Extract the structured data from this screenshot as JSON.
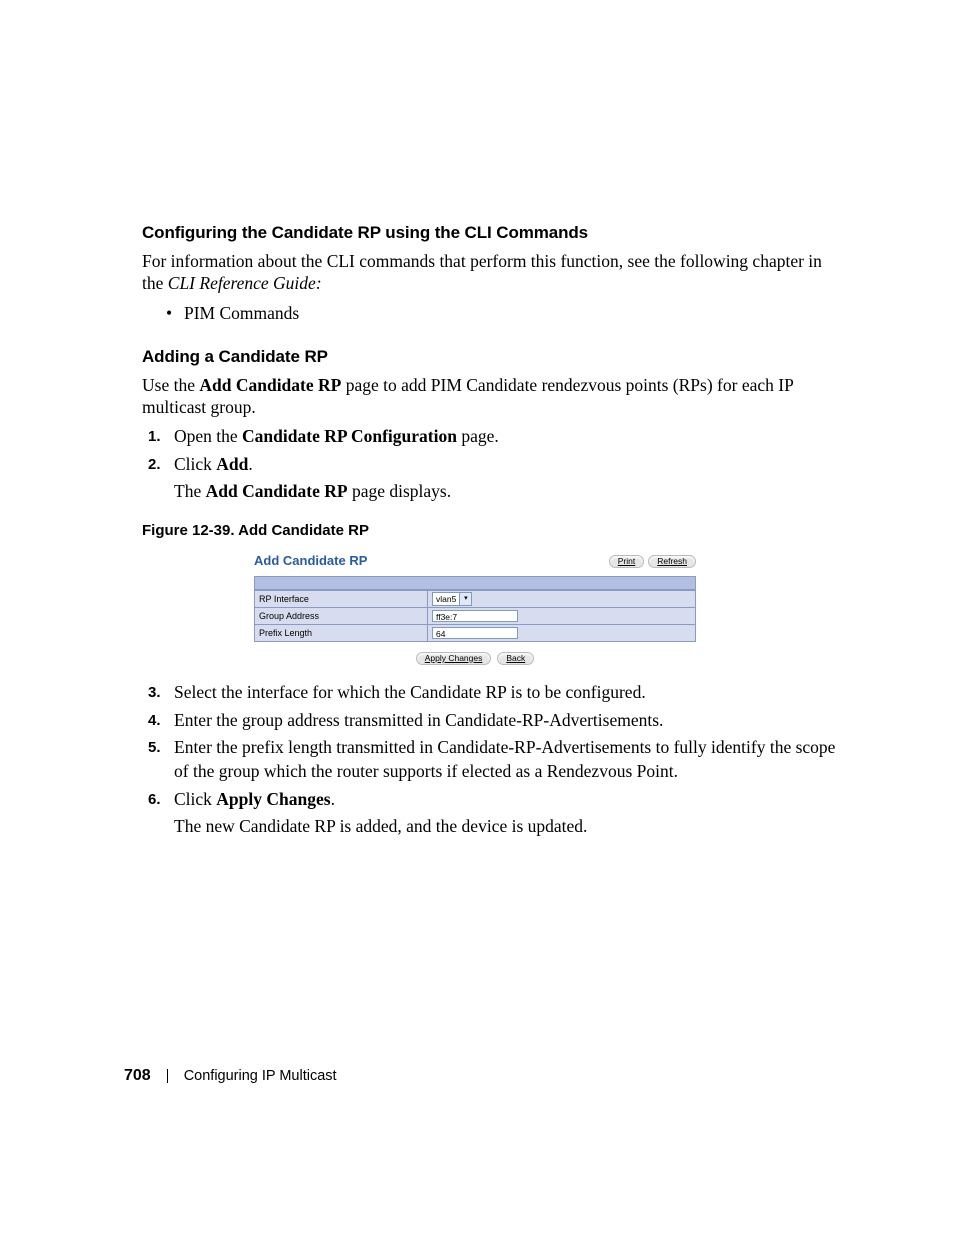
{
  "section1": {
    "heading": "Configuring the Candidate RP using the CLI Commands",
    "para_a": "For information about the CLI commands that perform this function, see the following chapter in the ",
    "para_b": "CLI Reference Guide:",
    "bullet1": "PIM Commands"
  },
  "section2": {
    "heading": "Adding a Candidate RP",
    "para_pre": "Use the ",
    "para_bold": "Add Candidate RP",
    "para_post": " page to add PIM Candidate rendezvous points (RPs) for each IP multicast group."
  },
  "steps_a": {
    "s1_pre": "Open the ",
    "s1_bold": "Candidate RP Configuration",
    "s1_post": " page.",
    "s2_pre": "Click ",
    "s2_bold": "Add",
    "s2_post": ".",
    "s2_sub_pre": "The ",
    "s2_sub_bold": "Add Candidate RP",
    "s2_sub_post": " page displays."
  },
  "figure": {
    "caption": "Figure 12-39.    Add Candidate RP",
    "panel_title": "Add Candidate RP",
    "btn_print": "Print",
    "btn_refresh": "Refresh",
    "row1_label": "RP Interface",
    "row1_value": "vlan5",
    "row2_label": "Group Address",
    "row2_value": "ff3e:7",
    "row3_label": "Prefix Length",
    "row3_value": "64",
    "btn_apply": "Apply Changes",
    "btn_back": "Back"
  },
  "steps_b": {
    "s3": "Select the interface for which the Candidate RP is to be configured.",
    "s4": "Enter the group address transmitted in Candidate-RP-Advertisements.",
    "s5": "Enter the prefix length transmitted in Candidate-RP-Advertisements to fully identify the scope of the group which the router supports if elected as a Rendezvous Point.",
    "s6_pre": "Click ",
    "s6_bold": "Apply Changes",
    "s6_post": ".",
    "s6_sub": "The new Candidate RP is added, and the device is updated."
  },
  "footer": {
    "page": "708",
    "chapter": "Configuring IP Multicast"
  }
}
